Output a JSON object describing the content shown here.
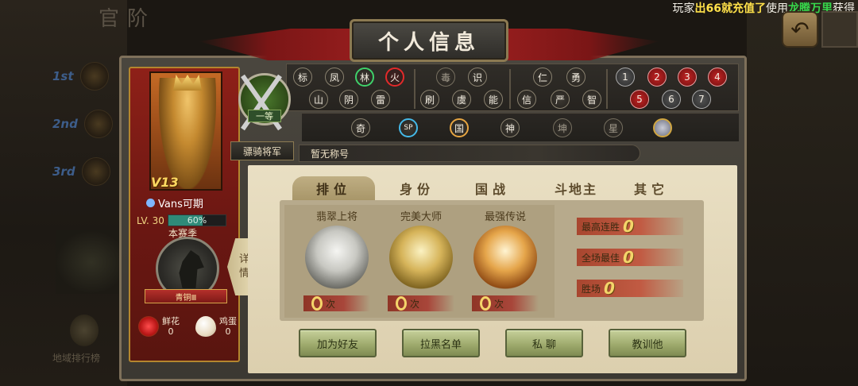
{
  "background": {
    "title": "官阶",
    "rank_labels": [
      "1st",
      "2nd",
      "3rd"
    ],
    "footer_label": "地域排行榜",
    "banner_label": "骠骑将军"
  },
  "marquee": {
    "prefix": "玩家",
    "amount": "出66",
    "mid": "就充值了",
    "use": "使用",
    "item": "龙腾万里",
    "suffix": "获得"
  },
  "window": {
    "title": "个人信息",
    "back_icon": "back-arrow-icon"
  },
  "profile": {
    "vip": "V13",
    "name": "Vans可期",
    "level": "LV. 30",
    "exp_percent": 60,
    "exp_label": "60%",
    "season_label": "本赛季",
    "rank_name": "青铜Ⅲ",
    "gifts": [
      {
        "name": "鲜花",
        "count": "0",
        "icon": "rose-icon"
      },
      {
        "name": "鸡蛋",
        "count": "0",
        "icon": "egg-icon"
      }
    ],
    "detail_tab": [
      "详",
      "情"
    ]
  },
  "title": {
    "emblem_label": "一等",
    "rank_title": "骠骑将军",
    "custom_title": "暂无称号"
  },
  "badges": {
    "group1_row1": [
      "标",
      "凤",
      "林",
      "火"
    ],
    "group1_row2": [
      "山",
      "阴",
      "雷"
    ],
    "group2_row1": [
      "毒",
      "识"
    ],
    "group2_row2": [
      "刷",
      "虞",
      "能"
    ],
    "group3_row1": [
      "仁",
      "勇"
    ],
    "group3_row2": [
      "信",
      "严",
      "智"
    ],
    "group4_row1": [
      "1",
      "2",
      "3",
      "4"
    ],
    "group4_row2": [
      "5",
      "6",
      "7"
    ],
    "row2": [
      "奇",
      "SP",
      "国",
      "神",
      "坤",
      "星",
      ""
    ]
  },
  "tabs": [
    "排位",
    "身份",
    "国战",
    "斗地主",
    "其它"
  ],
  "medals": [
    {
      "title": "翡翠上将",
      "count": "0",
      "unit": "次",
      "style": "silver"
    },
    {
      "title": "完美大师",
      "count": "0",
      "unit": "次",
      "style": "gold"
    },
    {
      "title": "最强传说",
      "count": "0",
      "unit": "次",
      "style": "legend"
    }
  ],
  "stats": [
    {
      "label": "最高连胜",
      "value": "0"
    },
    {
      "label": "全场最佳",
      "value": "0"
    },
    {
      "label": "胜场",
      "value": "0"
    }
  ],
  "actions": [
    "加为好友",
    "拉黑名单",
    "私 聊",
    "教训他"
  ],
  "colors": {
    "accent_red": "#8e2018",
    "button_green": "#9fab6e",
    "gold": "#f4d56a"
  }
}
